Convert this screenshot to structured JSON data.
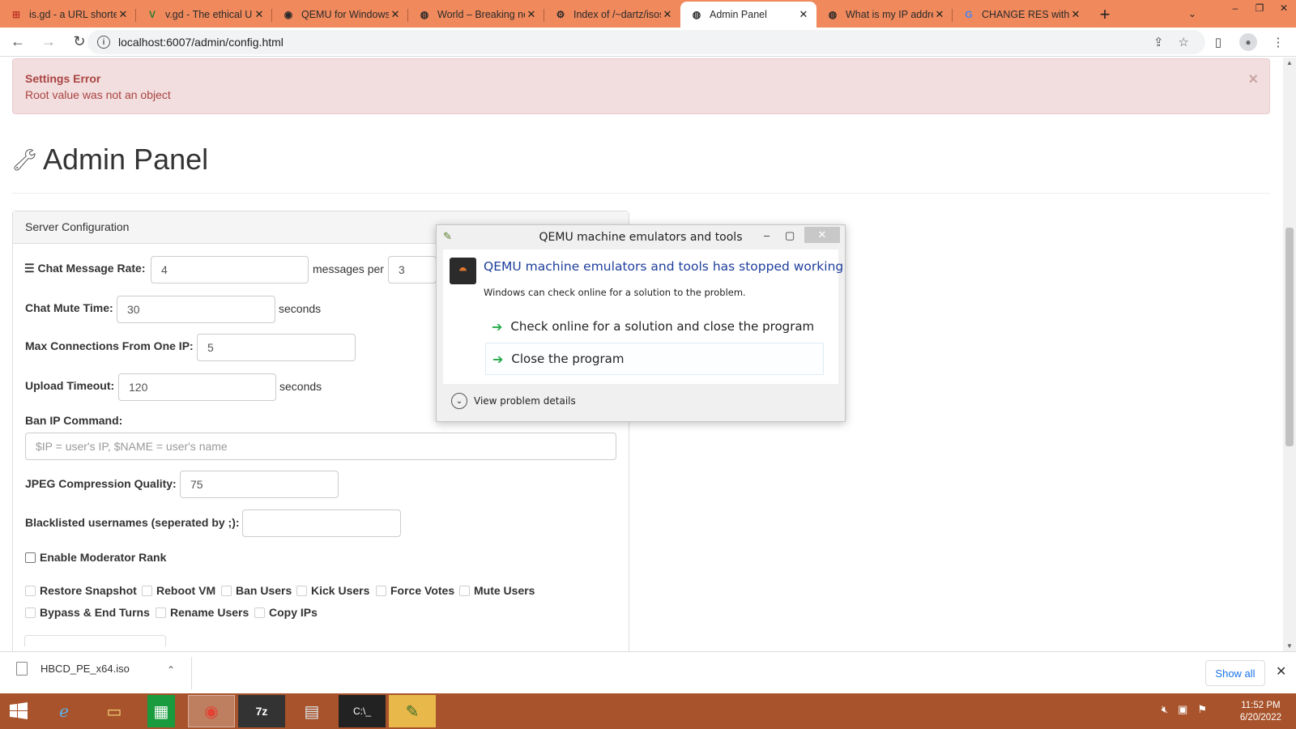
{
  "browser": {
    "tabs": [
      {
        "label": "is.gd - a URL shortener",
        "icon": "isgd-favicon",
        "glyph": "⊞"
      },
      {
        "label": "v.gd - The ethical URL shortener",
        "icon": "vgd-favicon",
        "glyph": "V"
      },
      {
        "label": "QEMU for Windows",
        "icon": "qemu-favicon",
        "glyph": "◉"
      },
      {
        "label": "World – Breaking news",
        "icon": "globe-favicon",
        "glyph": "◍"
      },
      {
        "label": "Index of /~dartz/isos",
        "icon": "index-favicon",
        "glyph": "⚙"
      },
      {
        "label": "Admin Panel",
        "icon": "globe-favicon",
        "glyph": "◍",
        "active": true
      },
      {
        "label": "What is my IP address",
        "icon": "globe-favicon",
        "glyph": "◍"
      },
      {
        "label": "CHANGE RES without",
        "icon": "google-favicon",
        "glyph": "G"
      }
    ],
    "new_tab": "+",
    "url": "localhost:6007/admin/config.html"
  },
  "page": {
    "alert": {
      "title": "Settings Error",
      "message": "Root value was not an object",
      "close": "×"
    },
    "title": "Admin Panel",
    "panel_title": "Server Configuration",
    "fields": {
      "chat_rate_label": "Chat Message Rate:",
      "chat_rate_value": "4",
      "chat_rate_suffix": "messages per",
      "chat_rate_seconds_value": "3",
      "mute_label": "Chat Mute Time:",
      "mute_value": "30",
      "mute_suffix": "seconds",
      "maxconn_label": "Max Connections From One IP:",
      "maxconn_value": "5",
      "upload_label": "Upload Timeout:",
      "upload_value": "120",
      "upload_suffix": "seconds",
      "ban_label": "Ban IP Command:",
      "ban_placeholder": "$IP = user's IP, $NAME = user's name",
      "jpeg_label": "JPEG Compression Quality:",
      "jpeg_value": "75",
      "blacklist_label": "Blacklisted usernames (seperated by ;):",
      "blacklist_value": ""
    },
    "moderator_label": "Enable Moderator Rank",
    "permissions": [
      "Restore Snapshot",
      "Reboot VM",
      "Ban Users",
      "Kick Users",
      "Force Votes",
      "Mute Users",
      "Bypass & End Turns",
      "Rename Users",
      "Copy IPs"
    ]
  },
  "dialog": {
    "title": "QEMU machine emulators and tools",
    "heading": "QEMU machine emulators and tools has stopped working",
    "subtext": "Windows can check online for a solution to the problem.",
    "option1": "Check online for a solution and close the program",
    "option2": "Close the program",
    "details": "View problem details"
  },
  "downloads": {
    "file": "HBCD_PE_x64.iso",
    "show_all": "Show all"
  },
  "taskbar": {
    "apps": [
      "internet-explorer-icon",
      "file-explorer-icon",
      "store-icon",
      "chrome-icon",
      "7zip-icon",
      "notepad-icon",
      "cmd-icon",
      "qemu-icon"
    ],
    "time": "11:52 PM",
    "date": "6/20/2022"
  }
}
